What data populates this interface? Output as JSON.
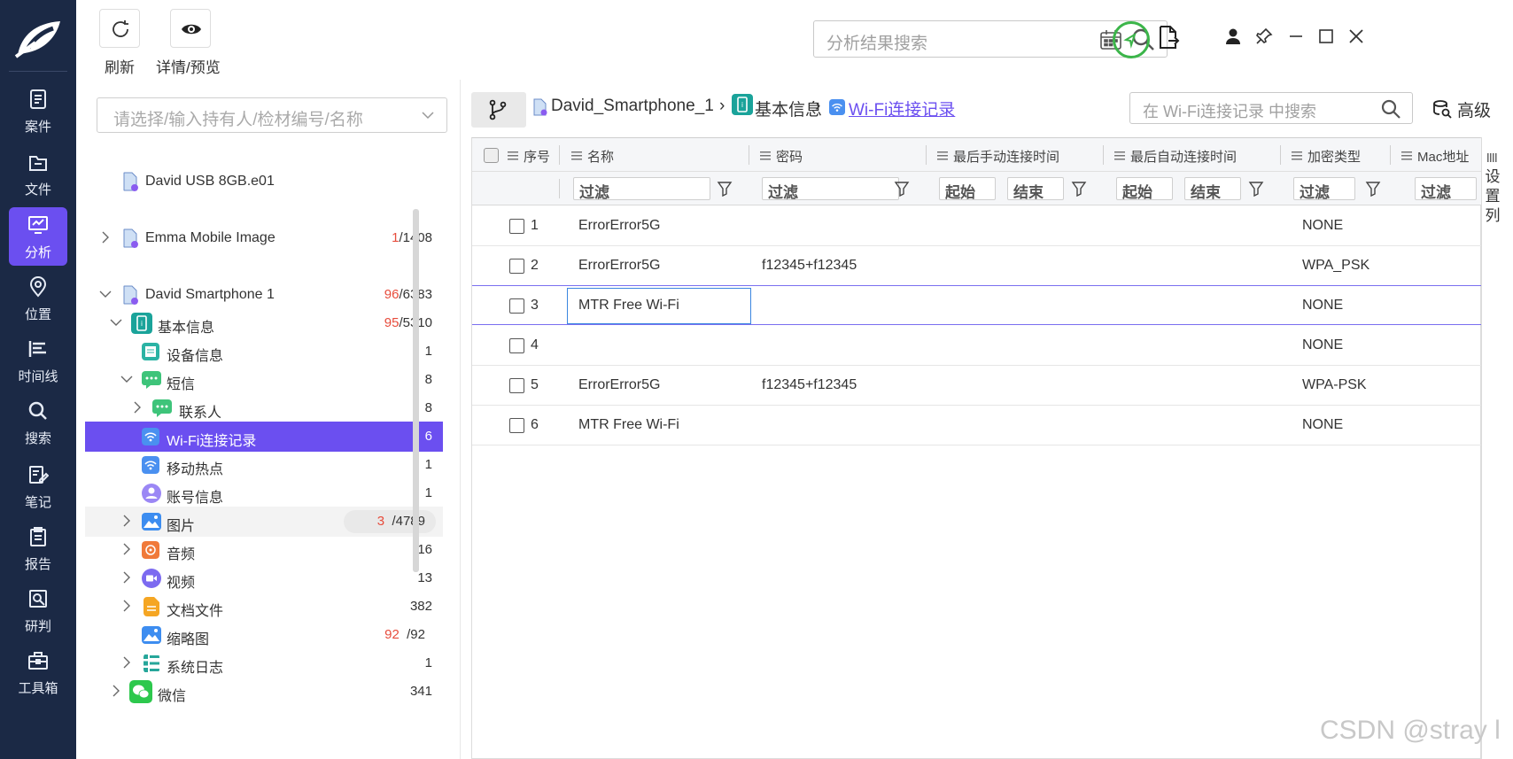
{
  "toolbar": {
    "refresh_label": "刷新",
    "details_label": "详情/预览",
    "search_placeholder": "分析结果搜索"
  },
  "nav": {
    "items": [
      {
        "label": "案件",
        "icon": "case-icon"
      },
      {
        "label": "文件",
        "icon": "file-icon"
      },
      {
        "label": "分析",
        "icon": "analysis-icon",
        "active": true
      },
      {
        "label": "位置",
        "icon": "location-icon"
      },
      {
        "label": "时间线",
        "icon": "timeline-icon"
      },
      {
        "label": "搜索",
        "icon": "search-icon"
      },
      {
        "label": "笔记",
        "icon": "notes-icon"
      },
      {
        "label": "报告",
        "icon": "report-icon"
      },
      {
        "label": "研判",
        "icon": "judgement-icon"
      },
      {
        "label": "工具箱",
        "icon": "toolbox-icon"
      }
    ]
  },
  "tree": {
    "filter_placeholder": "请选择/输入持有人/检材编号/名称",
    "items": [
      {
        "label": "David USB 8GB.e01"
      },
      {
        "label": "Emma Mobile Image",
        "count_red": "1",
        "count_total": "/1408"
      },
      {
        "label": "David Smartphone 1",
        "count_red": "96",
        "count_total": "/6383"
      },
      {
        "label": "基本信息",
        "count_red": "95",
        "count_total": "/5310"
      },
      {
        "label": "设备信息",
        "count": "1"
      },
      {
        "label": "短信",
        "count": "8"
      },
      {
        "label": "联系人",
        "count": "8"
      },
      {
        "label": "Wi-Fi连接记录",
        "count": "6"
      },
      {
        "label": "移动热点",
        "count": "1"
      },
      {
        "label": "账号信息",
        "count": "1"
      },
      {
        "label": "图片",
        "count_red": "3",
        "count_total": "/4789"
      },
      {
        "label": "音频",
        "count": "16"
      },
      {
        "label": "视频",
        "count": "13"
      },
      {
        "label": "文档文件",
        "count": "382"
      },
      {
        "label": "缩略图",
        "count_red": "92",
        "count_total": "/92"
      },
      {
        "label": "系统日志",
        "count": "1"
      },
      {
        "label": "微信",
        "count": "341"
      }
    ]
  },
  "breadcrumb": {
    "device": "David_Smartphone_1",
    "category": "基本信息",
    "current": "Wi-Fi连接记录",
    "separator": "›"
  },
  "tab_search": {
    "placeholder": "在 Wi-Fi连接记录 中搜索"
  },
  "advanced_label": "高级",
  "table": {
    "headers": [
      "序号",
      "名称",
      "密码",
      "最后手动连接时间",
      "最后自动连接时间",
      "加密类型",
      "Mac地址"
    ],
    "filter_placeholder": "过滤",
    "range_start": "起始",
    "range_end": "结束",
    "rows": [
      {
        "no": "1",
        "name": "ErrorError5G",
        "password": "",
        "enc": "NONE"
      },
      {
        "no": "2",
        "name": "ErrorError5G",
        "password": "f12345+f12345",
        "enc": "WPA_PSK"
      },
      {
        "no": "3",
        "name": "MTR Free Wi-Fi",
        "password": "",
        "enc": "NONE"
      },
      {
        "no": "4",
        "name": "",
        "password": "",
        "enc": "NONE"
      },
      {
        "no": "5",
        "name": "ErrorError5G",
        "password": "f12345+f12345",
        "enc": "WPA-PSK"
      },
      {
        "no": "6",
        "name": "MTR Free Wi-Fi",
        "password": "",
        "enc": "NONE"
      }
    ]
  },
  "settings_column_label": "设置列",
  "watermark": "CSDN @stray l",
  "colors": {
    "accent": "#6b4ff0",
    "nav_bg": "#1b2945",
    "sync_green": "#3cb54a",
    "count_red": "#e74c3c",
    "link": "#6b4ff0"
  }
}
